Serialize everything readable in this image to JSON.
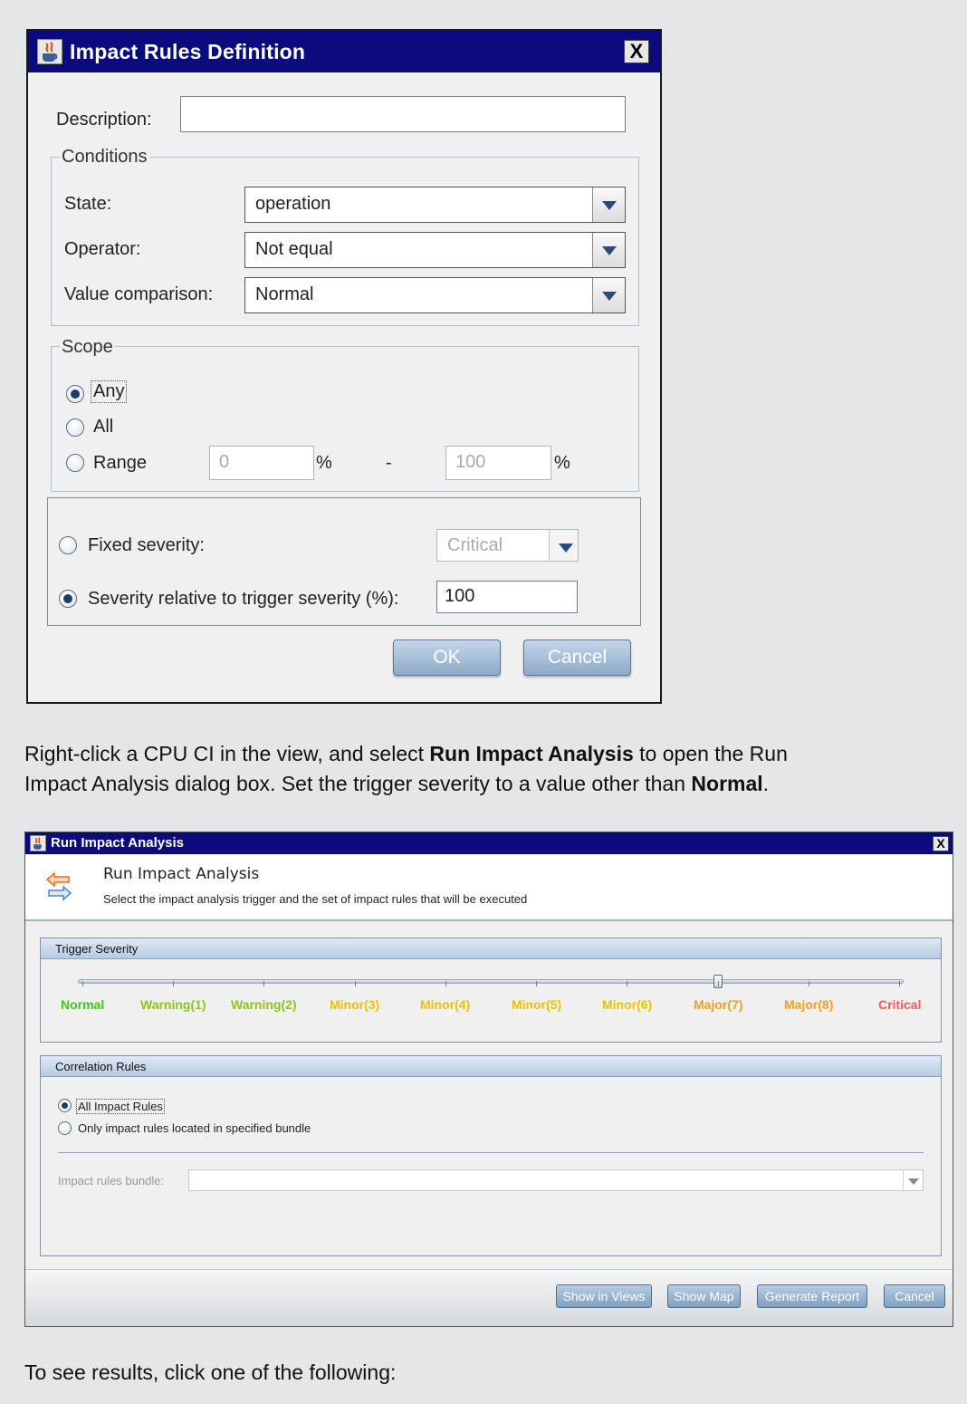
{
  "rules_dialog": {
    "title": "Impact Rules Definition",
    "close_glyph": "X",
    "description_label": "Description:",
    "description_value": "",
    "conditions": {
      "legend": "Conditions",
      "state_label": "State:",
      "state_value": "operation",
      "operator_label": "Operator:",
      "operator_value": "Not equal",
      "value_comparison_label": "Value comparison:",
      "value_comparison_value": "Normal"
    },
    "scope": {
      "legend": "Scope",
      "options": [
        "Any",
        "All",
        "Range"
      ],
      "selected": "Any",
      "range_from": "0",
      "range_to": "100",
      "percent": "%",
      "dash": "-"
    },
    "severity": {
      "fixed_label": "Fixed severity:",
      "fixed_value": "Critical",
      "relative_label": "Severity relative to trigger severity (%):",
      "relative_value": "100",
      "selected": "relative"
    },
    "ok_label": "OK",
    "cancel_label": "Cancel"
  },
  "paragraph1": {
    "part1": "Right-click a CPU CI in the view, and select ",
    "bold1": "Run Impact Analysis",
    "part2": " to open the Run",
    "part3": "Impact Analysis dialog box. Set the trigger severity to a value other than ",
    "bold2": "Normal",
    "part4": "."
  },
  "analysis_dialog": {
    "title": "Run Impact Analysis",
    "close_glyph": "X",
    "header_title": "Run Impact Analysis",
    "header_subtitle": "Select the impact analysis trigger and the set of impact rules that will be executed",
    "trigger_severity": {
      "heading": "Trigger Severity",
      "levels": [
        "Normal",
        "Warning(1)",
        "Warning(2)",
        "Minor(3)",
        "Minor(4)",
        "Minor(5)",
        "Minor(6)",
        "Major(7)",
        "Major(8)",
        "Critical"
      ],
      "selected_index": 7,
      "colors": {
        "normal": "#44c21e",
        "warning": "#8fc21e",
        "minor": "#e8c400",
        "major": "#f0a020",
        "critical": "#ff5a5a"
      }
    },
    "correlation_rules": {
      "heading": "Correlation Rules",
      "option_all": "All Impact Rules",
      "option_bundle": "Only impact rules located in specified bundle",
      "selected": "all",
      "bundle_label": "Impact rules bundle:",
      "bundle_value": ""
    },
    "buttons": {
      "show_in_views": "Show in Views",
      "show_map": "Show Map",
      "generate_report": "Generate Report",
      "cancel": "Cancel"
    }
  },
  "paragraph2": "To see results, click one of the following:"
}
